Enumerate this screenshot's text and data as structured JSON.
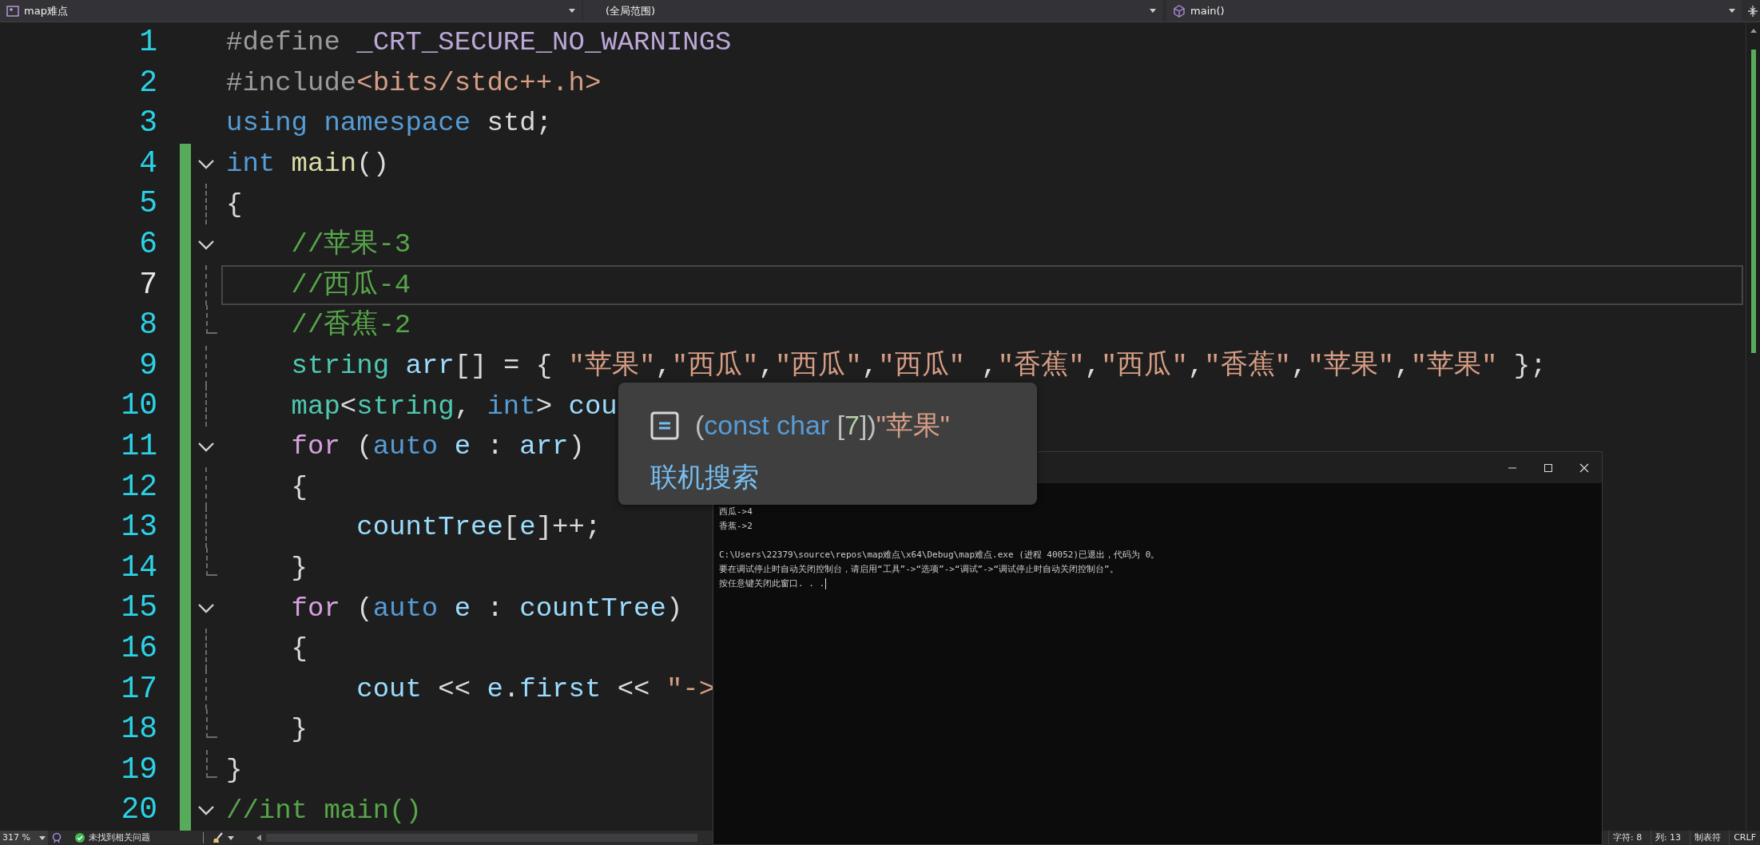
{
  "navigation_bar": {
    "project": {
      "label": "map难点"
    },
    "scope": {
      "label": "(全局范围)"
    },
    "member": {
      "label": "main()"
    }
  },
  "editor": {
    "lines": [
      {
        "number": "1",
        "foldable": false,
        "changed": false,
        "current": false,
        "in_block": false,
        "block_end": false,
        "tokens": [
          {
            "kind": "pp",
            "text": "#define"
          },
          {
            "kind": "macro",
            "text": " _CRT_SECURE_NO_WARNINGS"
          }
        ]
      },
      {
        "number": "2",
        "foldable": false,
        "changed": false,
        "current": false,
        "in_block": false,
        "block_end": false,
        "tokens": [
          {
            "kind": "pp",
            "text": "#include"
          },
          {
            "kind": "str",
            "text": "<bits/stdc++.h>"
          }
        ]
      },
      {
        "number": "3",
        "foldable": false,
        "changed": false,
        "current": false,
        "in_block": false,
        "block_end": false,
        "tokens": [
          {
            "kind": "kw",
            "text": "using"
          },
          {
            "kind": "kw",
            "text": " namespace"
          },
          {
            "kind": "plain",
            "text": " std;"
          }
        ]
      },
      {
        "number": "4",
        "foldable": true,
        "changed": true,
        "current": false,
        "in_block": false,
        "block_end": false,
        "tokens": [
          {
            "kind": "kw",
            "text": "int"
          },
          {
            "kind": "func",
            "text": " main"
          },
          {
            "kind": "plain",
            "text": "()"
          }
        ]
      },
      {
        "number": "5",
        "foldable": false,
        "changed": true,
        "current": false,
        "in_block": true,
        "block_end": false,
        "tokens": [
          {
            "kind": "plain",
            "text": "{"
          }
        ]
      },
      {
        "number": "6",
        "foldable": true,
        "changed": true,
        "current": false,
        "in_block": false,
        "block_end": false,
        "tokens": [
          {
            "kind": "comment",
            "text": "    //苹果-3"
          }
        ]
      },
      {
        "number": "7",
        "foldable": false,
        "changed": true,
        "current": true,
        "in_block": true,
        "block_end": false,
        "tokens": [
          {
            "kind": "comment",
            "text": "    //西瓜-4"
          }
        ]
      },
      {
        "number": "8",
        "foldable": false,
        "changed": true,
        "current": false,
        "in_block": false,
        "block_end": true,
        "tokens": [
          {
            "kind": "comment",
            "text": "    //香蕉-2"
          }
        ]
      },
      {
        "number": "9",
        "foldable": false,
        "changed": true,
        "current": false,
        "in_block": true,
        "block_end": false,
        "tokens": [
          {
            "kind": "type",
            "text": "    string"
          },
          {
            "kind": "var",
            "text": " arr"
          },
          {
            "kind": "plain",
            "text": "[] = { "
          },
          {
            "kind": "str",
            "text": "\"苹果\""
          },
          {
            "kind": "plain",
            "text": ","
          },
          {
            "kind": "str",
            "text": "\"西瓜\""
          },
          {
            "kind": "plain",
            "text": ","
          },
          {
            "kind": "str",
            "text": "\"西瓜\""
          },
          {
            "kind": "plain",
            "text": ","
          },
          {
            "kind": "str",
            "text": "\"西瓜\""
          },
          {
            "kind": "plain",
            "text": " ,"
          },
          {
            "kind": "str",
            "text": "\"香蕉\""
          },
          {
            "kind": "plain",
            "text": ","
          },
          {
            "kind": "str",
            "text": "\"西瓜\""
          },
          {
            "kind": "plain",
            "text": ","
          },
          {
            "kind": "str",
            "text": "\"香蕉\""
          },
          {
            "kind": "plain",
            "text": ","
          },
          {
            "kind": "str",
            "text": "\"苹果\""
          },
          {
            "kind": "plain",
            "text": ","
          },
          {
            "kind": "str",
            "text": "\"苹果\""
          },
          {
            "kind": "plain",
            "text": " };"
          }
        ]
      },
      {
        "number": "10",
        "foldable": false,
        "changed": true,
        "current": false,
        "in_block": true,
        "block_end": false,
        "tokens": [
          {
            "kind": "type",
            "text": "    map"
          },
          {
            "kind": "plain",
            "text": "<"
          },
          {
            "kind": "type",
            "text": "string"
          },
          {
            "kind": "plain",
            "text": ", "
          },
          {
            "kind": "kw",
            "text": "int"
          },
          {
            "kind": "plain",
            "text": "> "
          },
          {
            "kind": "var",
            "text": "cou"
          }
        ]
      },
      {
        "number": "11",
        "foldable": true,
        "changed": true,
        "current": false,
        "in_block": false,
        "block_end": false,
        "tokens": [
          {
            "kind": "ctl",
            "text": "    for"
          },
          {
            "kind": "plain",
            "text": " ("
          },
          {
            "kind": "kw",
            "text": "auto"
          },
          {
            "kind": "var",
            "text": " e"
          },
          {
            "kind": "plain",
            "text": " : "
          },
          {
            "kind": "var",
            "text": "arr"
          },
          {
            "kind": "plain",
            "text": ")"
          }
        ]
      },
      {
        "number": "12",
        "foldable": false,
        "changed": true,
        "current": false,
        "in_block": true,
        "block_end": false,
        "tokens": [
          {
            "kind": "plain",
            "text": "    {"
          }
        ]
      },
      {
        "number": "13",
        "foldable": false,
        "changed": true,
        "current": false,
        "in_block": true,
        "block_end": false,
        "tokens": [
          {
            "kind": "var",
            "text": "        countTree"
          },
          {
            "kind": "plain",
            "text": "["
          },
          {
            "kind": "var",
            "text": "e"
          },
          {
            "kind": "plain",
            "text": "]++;"
          }
        ]
      },
      {
        "number": "14",
        "foldable": false,
        "changed": true,
        "current": false,
        "in_block": false,
        "block_end": true,
        "tokens": [
          {
            "kind": "plain",
            "text": "    }"
          }
        ]
      },
      {
        "number": "15",
        "foldable": true,
        "changed": true,
        "current": false,
        "in_block": false,
        "block_end": false,
        "tokens": [
          {
            "kind": "ctl",
            "text": "    for"
          },
          {
            "kind": "plain",
            "text": " ("
          },
          {
            "kind": "kw",
            "text": "auto"
          },
          {
            "kind": "var",
            "text": " e"
          },
          {
            "kind": "plain",
            "text": " : "
          },
          {
            "kind": "var",
            "text": "countTree"
          },
          {
            "kind": "plain",
            "text": ")"
          }
        ]
      },
      {
        "number": "16",
        "foldable": false,
        "changed": true,
        "current": false,
        "in_block": true,
        "block_end": false,
        "tokens": [
          {
            "kind": "plain",
            "text": "    {"
          }
        ]
      },
      {
        "number": "17",
        "foldable": false,
        "changed": true,
        "current": false,
        "in_block": true,
        "block_end": false,
        "tokens": [
          {
            "kind": "var",
            "text": "        cout"
          },
          {
            "kind": "plain",
            "text": " << "
          },
          {
            "kind": "var",
            "text": "e"
          },
          {
            "kind": "plain",
            "text": "."
          },
          {
            "kind": "var",
            "text": "first"
          },
          {
            "kind": "plain",
            "text": " << "
          },
          {
            "kind": "str",
            "text": "\"->"
          }
        ]
      },
      {
        "number": "18",
        "foldable": false,
        "changed": true,
        "current": false,
        "in_block": false,
        "block_end": true,
        "tokens": [
          {
            "kind": "plain",
            "text": "    }"
          }
        ]
      },
      {
        "number": "19",
        "foldable": false,
        "changed": true,
        "current": false,
        "in_block": false,
        "block_end": true,
        "tokens": [
          {
            "kind": "plain",
            "text": "}"
          }
        ]
      },
      {
        "number": "20",
        "foldable": true,
        "changed": true,
        "current": false,
        "in_block": false,
        "block_end": false,
        "tokens": [
          {
            "kind": "comment",
            "text": "//int main()"
          }
        ]
      }
    ]
  },
  "quick_info": {
    "signature": [
      {
        "kind": "punc",
        "text": "("
      },
      {
        "kind": "kw",
        "text": "const char"
      },
      {
        "kind": "punc",
        "text": " ["
      },
      {
        "kind": "num",
        "text": "7"
      },
      {
        "kind": "punc",
        "text": "])"
      },
      {
        "kind": "str",
        "text": "\"苹果\""
      }
    ],
    "link": "联机搜索"
  },
  "console": {
    "output": [
      {
        "text": "西瓜->4"
      },
      {
        "text": "香蕉->2"
      }
    ],
    "exit_message": [
      {
        "text": "C:\\Users\\22379\\source\\repos\\map难点\\x64\\Debug\\map难点.exe (进程 40052)已退出，代码为 0。"
      },
      {
        "text": "要在调试停止时自动关闭控制台，请启用“工具”->“选项”->“调试”->“调试停止时自动关闭控制台”。"
      },
      {
        "text": "按任意键关闭此窗口. . ."
      }
    ]
  },
  "status_bar": {
    "zoom": "317 %",
    "issues": "未找到相关问题",
    "items": [
      {
        "text": "字符: 8"
      },
      {
        "text": "列: 13"
      },
      {
        "text": "制表符"
      },
      {
        "text": "CRLF"
      }
    ]
  }
}
